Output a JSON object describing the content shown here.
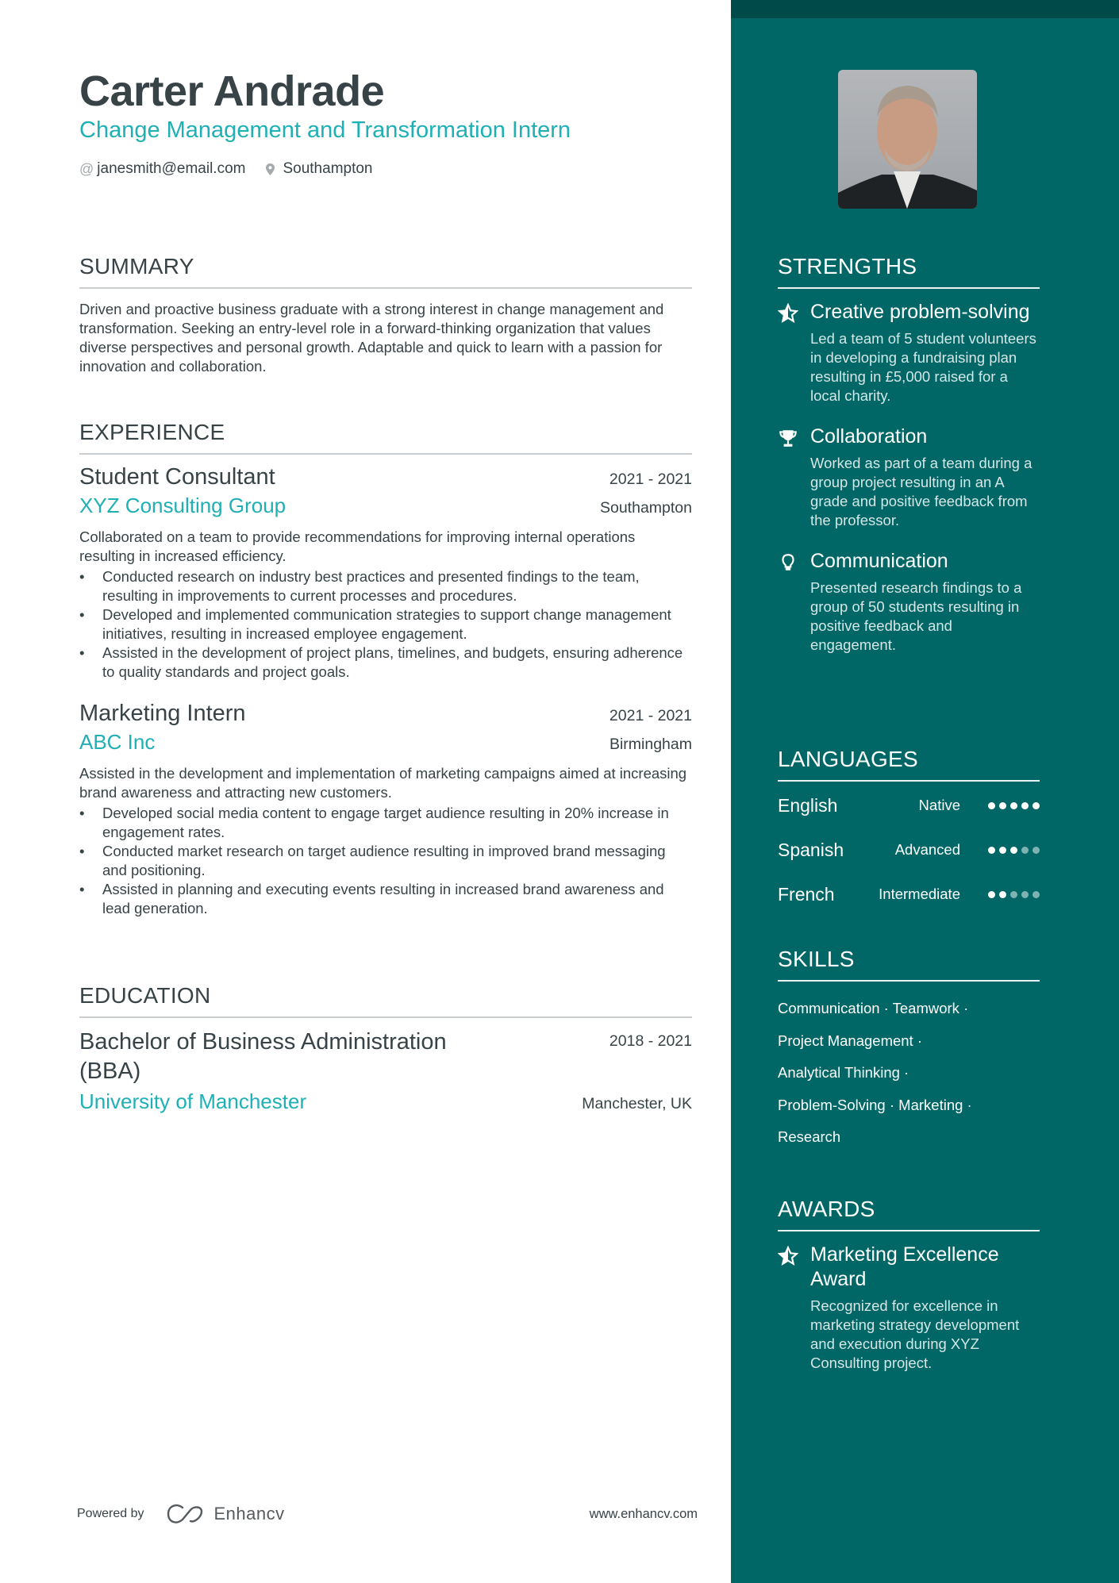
{
  "header": {
    "name": "Carter Andrade",
    "title": "Change Management and Transformation Intern",
    "email": "janesmith@email.com",
    "location": "Southampton",
    "email_icon": "at-icon",
    "location_icon": "map-pin-icon"
  },
  "summary": {
    "heading": "SUMMARY",
    "text": "Driven and proactive business graduate with a strong interest in change management and transformation. Seeking an entry-level role in a forward-thinking organization that values diverse perspectives and personal growth. Adaptable and quick to learn with a passion for innovation and collaboration."
  },
  "experience": {
    "heading": "EXPERIENCE",
    "jobs": [
      {
        "title": "Student Consultant",
        "dates": "2021 - 2021",
        "company": "XYZ Consulting Group",
        "location": "Southampton",
        "description": "Collaborated on a team to provide recommendations for improving internal operations resulting in increased efficiency.",
        "bullets": [
          "Conducted research on industry best practices and presented findings to the team, resulting in improvements to current processes and procedures.",
          "Developed and implemented communication strategies to support change management initiatives, resulting in increased employee engagement.",
          "Assisted in the development of project plans, timelines, and budgets, ensuring adherence to quality standards and project goals."
        ]
      },
      {
        "title": "Marketing Intern",
        "dates": "2021 - 2021",
        "company": "ABC Inc",
        "location": "Birmingham",
        "description": "Assisted in the development and implementation of marketing campaigns aimed at increasing brand awareness and attracting new customers.",
        "bullets": [
          "Developed social media content to engage target audience resulting in 20% increase in engagement rates.",
          "Conducted market research on target audience resulting in improved brand messaging and positioning.",
          "Assisted in planning and executing events resulting in increased brand awareness and lead generation."
        ]
      }
    ]
  },
  "education": {
    "heading": "EDUCATION",
    "items": [
      {
        "degree": "Bachelor of Business Administration (BBA)",
        "dates": "2018 - 2021",
        "school": "University of Manchester",
        "location": "Manchester, UK"
      }
    ]
  },
  "strengths": {
    "heading": "STRENGTHS",
    "items": [
      {
        "icon": "star-icon",
        "title": "Creative problem-solving",
        "description": "Led a team of 5 student volunteers in developing a fundraising plan resulting in £5,000 raised for a local charity."
      },
      {
        "icon": "trophy-icon",
        "title": "Collaboration",
        "description": "Worked as part of a team during a group project resulting in an A grade and positive feedback from the professor."
      },
      {
        "icon": "lightbulb-icon",
        "title": "Communication",
        "description": "Presented research findings to a group of 50 students resulting in positive feedback and engagement."
      }
    ]
  },
  "languages": {
    "heading": "LANGUAGES",
    "items": [
      {
        "name": "English",
        "level": "Native",
        "rating": 5,
        "max": 5
      },
      {
        "name": "Spanish",
        "level": "Advanced",
        "rating": 3,
        "max": 5
      },
      {
        "name": "French",
        "level": "Intermediate",
        "rating": 2,
        "max": 5
      }
    ]
  },
  "skills": {
    "heading": "SKILLS",
    "lines": [
      "Communication · Teamwork ·",
      "Project Management ·",
      "Analytical Thinking ·",
      "Problem-Solving · Marketing ·",
      "Research"
    ]
  },
  "awards": {
    "heading": "AWARDS",
    "items": [
      {
        "icon": "star-icon",
        "title": "Marketing Excellence Award",
        "description": "Recognized for excellence in marketing strategy development and execution during XYZ Consulting project."
      }
    ]
  },
  "footer": {
    "powered_by": "Powered by",
    "brand": "Enhancv",
    "url": "www.enhancv.com"
  },
  "colors": {
    "accent": "#1eb0b5",
    "sidebar": "#006766",
    "sidebar_band": "#004a49",
    "text": "#384347"
  }
}
